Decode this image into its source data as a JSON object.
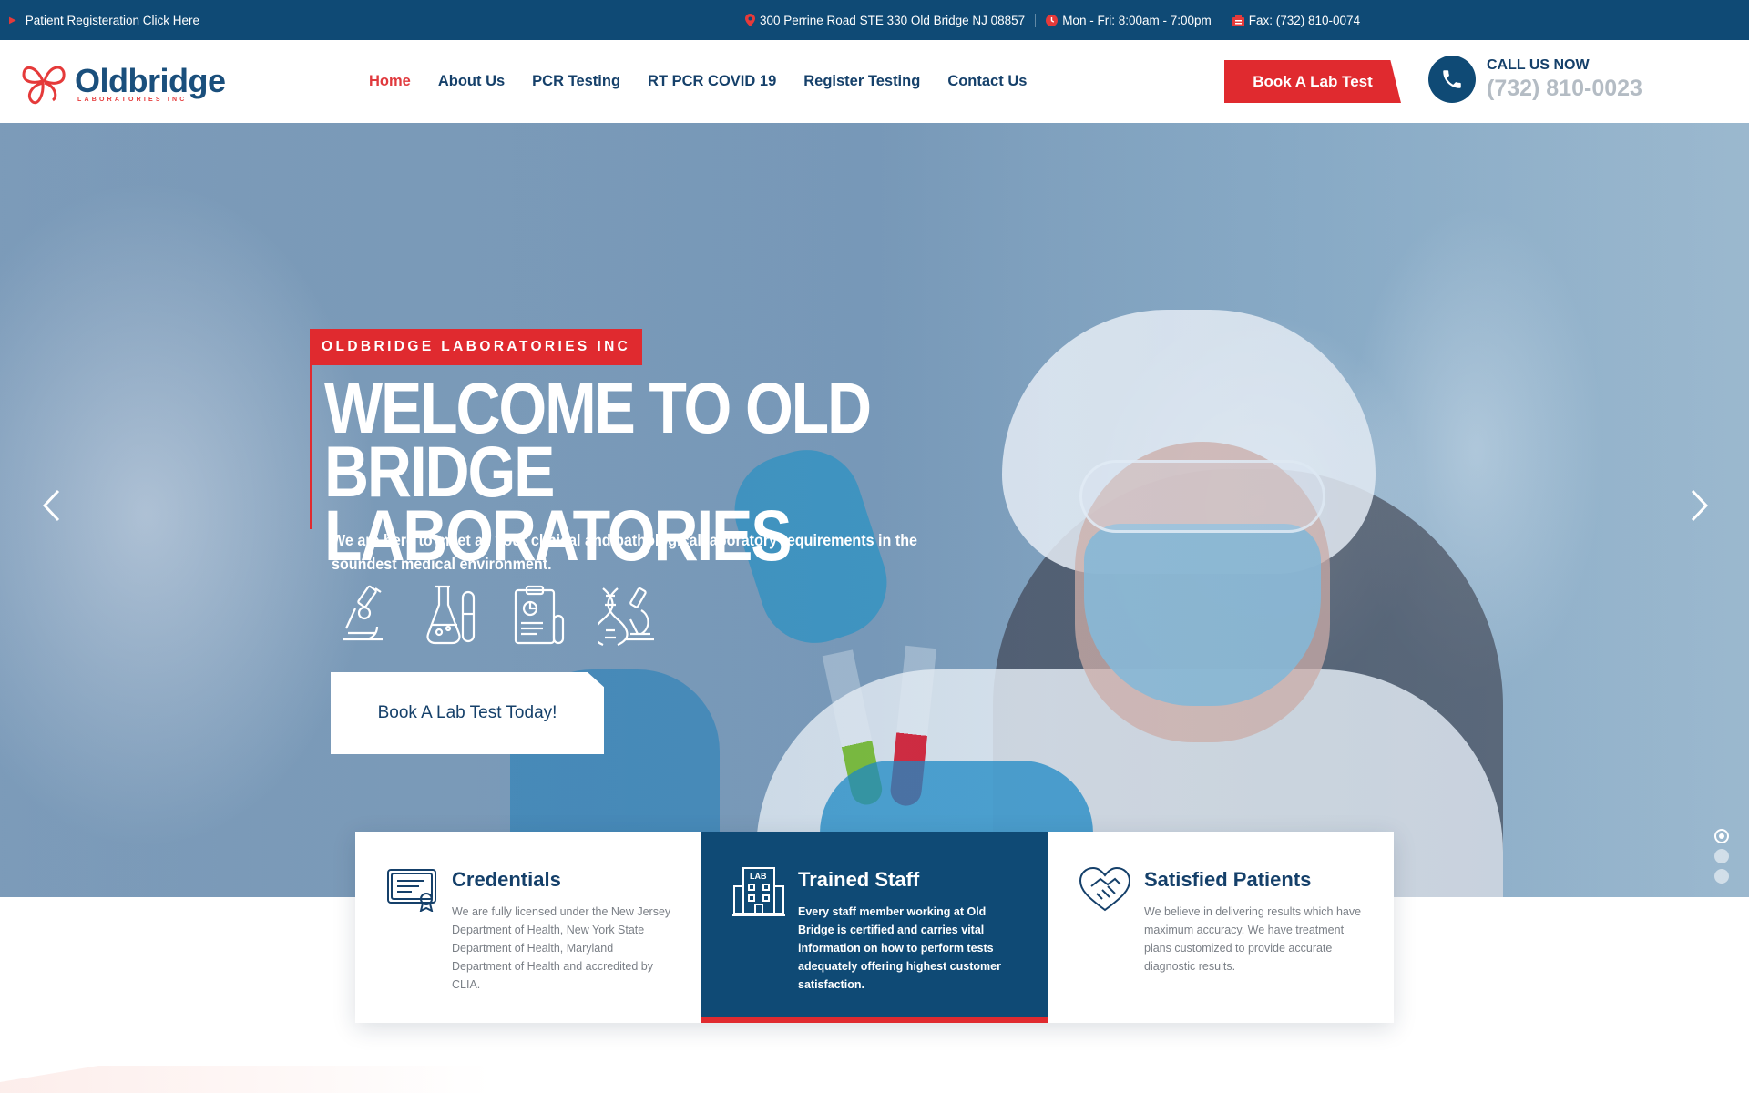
{
  "topbar": {
    "registration_link": "Patient Registeration Click Here",
    "address": "300 Perrine Road STE 330 Old Bridge NJ 08857",
    "hours": "Mon - Fri: 8:00am - 7:00pm",
    "fax": "Fax: (732) 810-0074"
  },
  "header": {
    "logo": {
      "name": "Oldbridge",
      "sub": "LABORATORIES INC"
    },
    "nav": [
      {
        "label": "Home",
        "active": true
      },
      {
        "label": "About Us"
      },
      {
        "label": "PCR Testing"
      },
      {
        "label": "RT PCR COVID 19"
      },
      {
        "label": "Register Testing"
      },
      {
        "label": "Contact Us"
      }
    ],
    "book_button": "Book A Lab Test",
    "call_label": "CALL US NOW",
    "call_number": "(732) 810-0023"
  },
  "hero": {
    "tag": "OLDBRIDGE LABORATORIES INC",
    "title_line1": "WELCOME TO OLD",
    "title_line2": "BRIDGE LABORATORIES",
    "subtitle": "We are here to meet all your clinical and pathological laboratory requirements in the soundest medical environment.",
    "icons": [
      "microscope-icon",
      "flask-test-tube-icon",
      "clipboard-report-icon",
      "dna-microscope-icon"
    ],
    "cta": "Book A Lab Test Today!",
    "slides": 3,
    "active_slide": 1
  },
  "features": [
    {
      "icon": "certificate-icon",
      "title": "Credentials",
      "text": "We are fully licensed under the New Jersey Department of Health, New York State Department of Health, Maryland Department of Health and accredited by CLIA."
    },
    {
      "icon": "lab-building-icon",
      "title": "Trained Staff",
      "text": "Every staff member working at Old Bridge is certified and carries vital information on how to perform tests adequately offering highest customer satisfaction."
    },
    {
      "icon": "heart-handshake-icon",
      "title": "Satisfied Patients",
      "text": "We believe in delivering results which have maximum accuracy. We have treatment plans customized to provide accurate diagnostic results."
    }
  ],
  "colors": {
    "navy": "#0f4a75",
    "red": "#e02a2f",
    "nav_text": "#15406a"
  }
}
